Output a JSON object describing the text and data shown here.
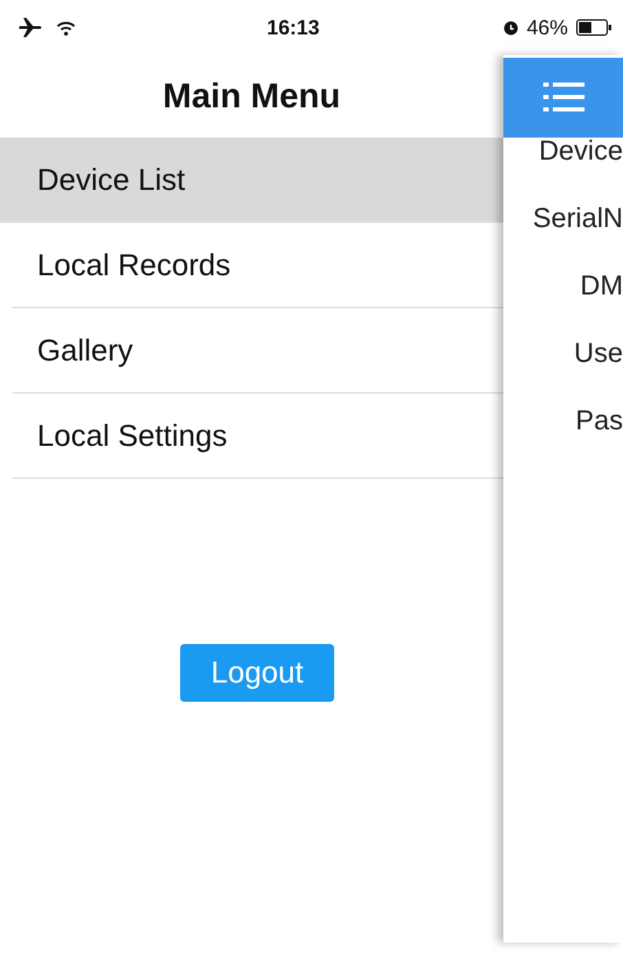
{
  "status_bar": {
    "time": "16:13",
    "battery": "46%"
  },
  "menu": {
    "title": "Main Menu",
    "items": [
      {
        "label": "Device List",
        "selected": true
      },
      {
        "label": "Local Records",
        "selected": false
      },
      {
        "label": "Gallery",
        "selected": false
      },
      {
        "label": "Local Settings",
        "selected": false
      }
    ],
    "logout": "Logout"
  },
  "side_panel": {
    "labels": [
      "Device",
      "SerialN",
      "DM",
      "Use",
      "Pas"
    ]
  }
}
